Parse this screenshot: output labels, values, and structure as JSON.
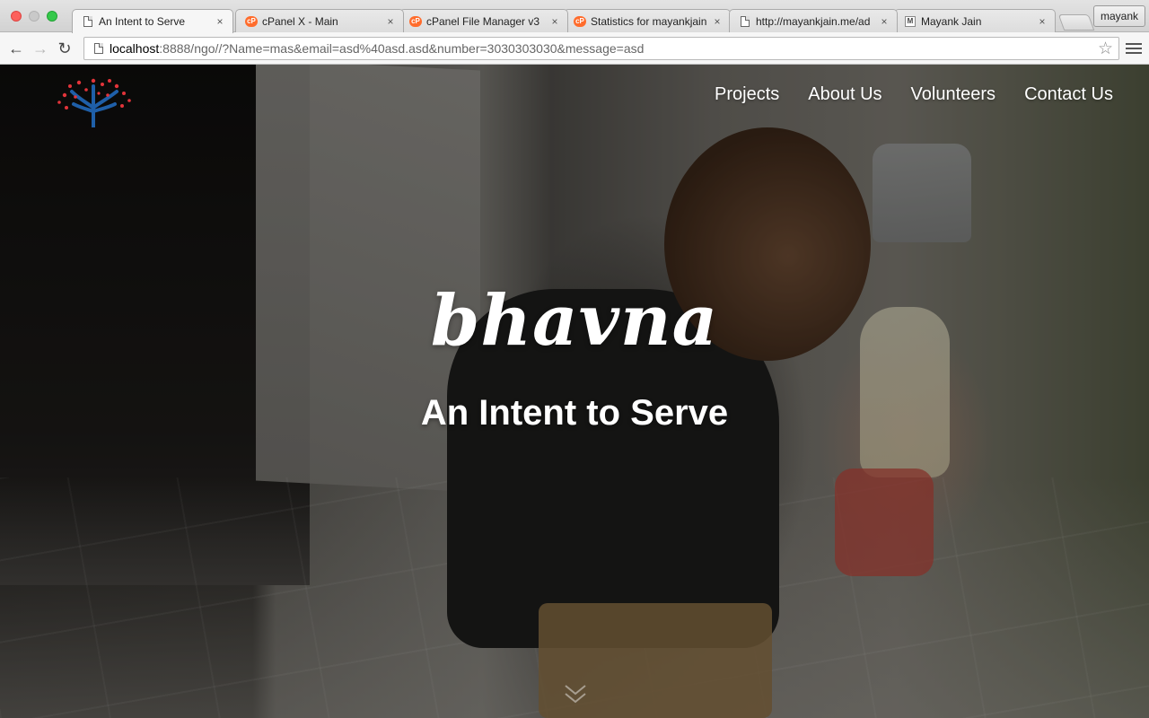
{
  "browser": {
    "tabs": [
      {
        "title": "An Intent to Serve",
        "icon": "document-icon",
        "active": true
      },
      {
        "title": "cPanel X - Main",
        "icon": "cpanel-icon",
        "active": false
      },
      {
        "title": "cPanel File Manager v3",
        "icon": "cpanel-icon",
        "active": false
      },
      {
        "title": "Statistics for mayankjain",
        "icon": "cpanel-icon",
        "active": false
      },
      {
        "title": "http://mayankjain.me/ad",
        "icon": "document-icon",
        "active": false
      },
      {
        "title": "Mayank Jain",
        "icon": "m-favicon-icon",
        "active": false
      }
    ],
    "tab_close_glyph": "×",
    "profile_name": "mayank",
    "url_host": "localhost",
    "url_rest": ":8888/ngo//?Name=mas&email=asd%40asd.asd&number=3030303030&message=asd",
    "back_glyph": "←",
    "forward_glyph": "→",
    "reload_glyph": "↻",
    "star_glyph": "☆"
  },
  "site": {
    "nav": [
      "Projects",
      "About Us",
      "Volunteers",
      "Contact Us"
    ],
    "brand": "bhavna",
    "tagline": "An Intent to Serve",
    "logo_icon": "tree-logo-icon",
    "scroll_icon": "double-chevron-down-icon",
    "colors": {
      "logo_tree": "#1f5fa8",
      "logo_dots": "#e2343a"
    }
  }
}
